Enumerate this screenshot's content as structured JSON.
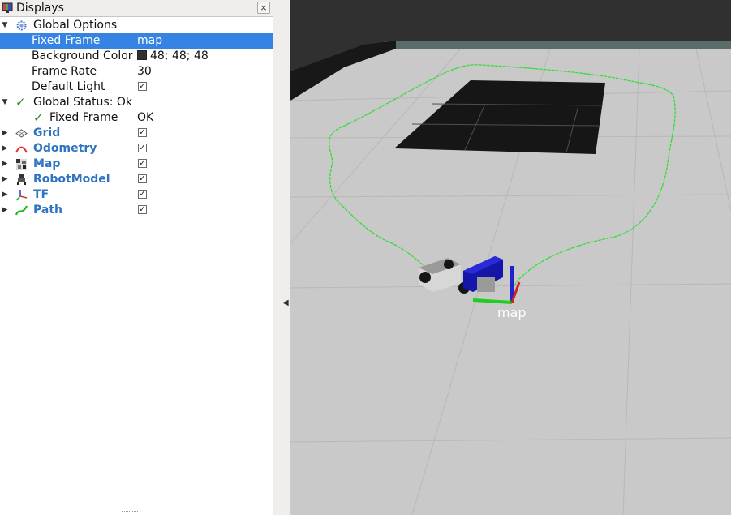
{
  "panel": {
    "title": "Displays",
    "close_label": "×"
  },
  "tree": {
    "global_options": {
      "label": "Global Options",
      "fixed_frame": {
        "label": "Fixed Frame",
        "value": "map"
      },
      "background_color": {
        "label": "Background Color",
        "value": "48; 48; 48",
        "swatch": "#303030"
      },
      "frame_rate": {
        "label": "Frame Rate",
        "value": "30"
      },
      "default_light": {
        "label": "Default Light",
        "checked": true
      }
    },
    "global_status": {
      "label": "Global Status: Ok",
      "fixed_frame": {
        "label": "Fixed Frame",
        "value": "OK"
      }
    },
    "displays": [
      {
        "label": "Grid",
        "icon": "grid-icon",
        "checked": true
      },
      {
        "label": "Odometry",
        "icon": "odometry-icon",
        "checked": true
      },
      {
        "label": "Map",
        "icon": "map-icon",
        "checked": true
      },
      {
        "label": "RobotModel",
        "icon": "robot-model-icon",
        "checked": true
      },
      {
        "label": "TF",
        "icon": "tf-icon",
        "checked": true
      },
      {
        "label": "Path",
        "icon": "path-icon",
        "checked": true
      }
    ],
    "check_glyph": "✓"
  },
  "view": {
    "frame_label": "map",
    "background_color": "#303030",
    "path_color": "#33dd33",
    "axis_colors": {
      "x": "#cc2222",
      "y": "#22cc22",
      "z": "#2222cc"
    }
  }
}
